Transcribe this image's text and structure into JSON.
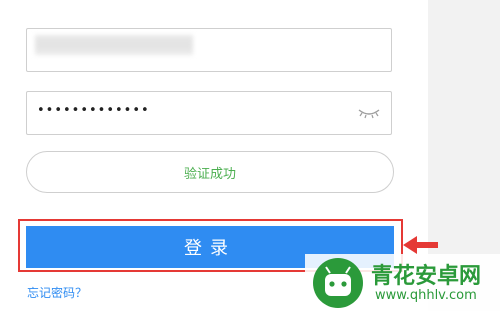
{
  "login_form": {
    "username_value": "",
    "password_masked": "•••••••••••••",
    "verify_status": "验证成功",
    "login_label": "登录",
    "forgot_password": "忘记密码？"
  },
  "watermark": {
    "title": "青花安卓网",
    "url": "www.qhhlv.com"
  },
  "colors": {
    "primary": "#2f8cf2",
    "success": "#4caf50",
    "highlight": "#e53935",
    "watermark": "#2b9a3a"
  },
  "icons": {
    "password_toggle": "eye-closed-icon",
    "annotation": "red-arrow-icon",
    "watermark_logo": "qinghua-logo-icon"
  }
}
